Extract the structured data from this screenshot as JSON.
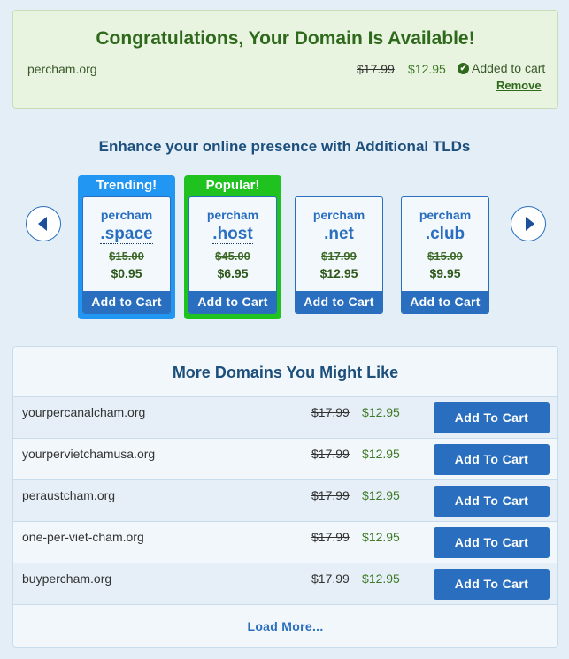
{
  "availability": {
    "title": "Congratulations, Your Domain Is Available!",
    "domain": "percham.org",
    "old_price": "$17.99",
    "new_price": "$12.95",
    "status": "Added to cart",
    "remove_label": "Remove"
  },
  "tlds": {
    "heading": "Enhance your online presence with Additional TLDs",
    "cards": [
      {
        "flag": "Trending!",
        "name": "percham",
        "ext": ".space",
        "old_price": "$15.00",
        "new_price": "$0.95",
        "button": "Add to Cart"
      },
      {
        "flag": "Popular!",
        "name": "percham",
        "ext": ".host",
        "old_price": "$45.00",
        "new_price": "$6.95",
        "button": "Add to Cart"
      },
      {
        "flag": "",
        "name": "percham",
        "ext": ".net",
        "old_price": "$17.99",
        "new_price": "$12.95",
        "button": "Add to Cart"
      },
      {
        "flag": "",
        "name": "percham",
        "ext": ".club",
        "old_price": "$15.00",
        "new_price": "$9.95",
        "button": "Add to Cart"
      }
    ],
    "prev_icon": "chevron-left-icon",
    "next_icon": "chevron-right-icon"
  },
  "more": {
    "title": "More Domains You Might Like",
    "rows": [
      {
        "domain": "yourpercanalcham.org",
        "old_price": "$17.99",
        "new_price": "$12.95",
        "button": "Add To Cart"
      },
      {
        "domain": "yourpervietchamusa.org",
        "old_price": "$17.99",
        "new_price": "$12.95",
        "button": "Add To Cart"
      },
      {
        "domain": "peraustcham.org",
        "old_price": "$17.99",
        "new_price": "$12.95",
        "button": "Add To Cart"
      },
      {
        "domain": "one-per-viet-cham.org",
        "old_price": "$17.99",
        "new_price": "$12.95",
        "button": "Add To Cart"
      },
      {
        "domain": "buypercham.org",
        "old_price": "$17.99",
        "new_price": "$12.95",
        "button": "Add To Cart"
      }
    ],
    "load_more": "Load More..."
  },
  "colors": {
    "trending": "#2196f3",
    "popular": "#1fc21f",
    "accent": "#2a6fbf"
  }
}
